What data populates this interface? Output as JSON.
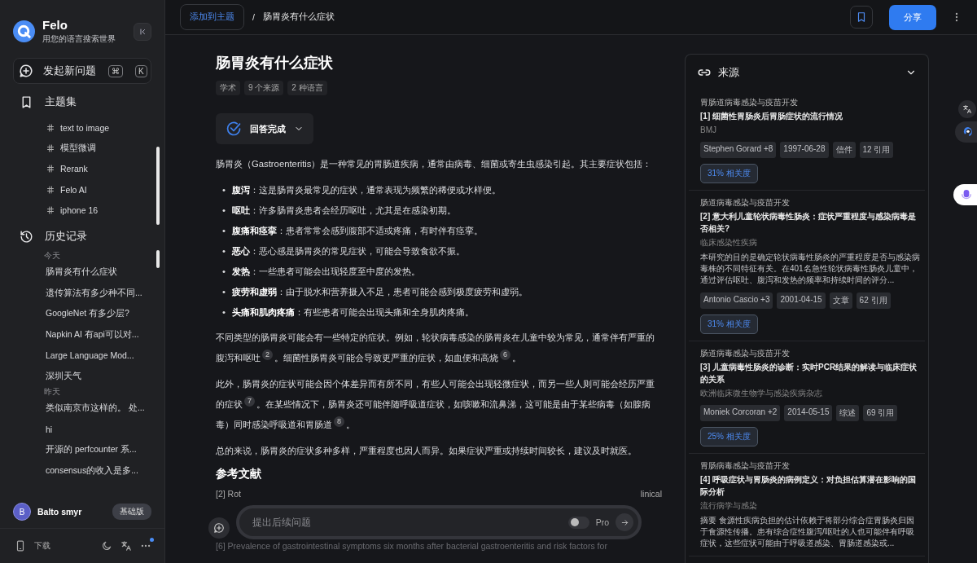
{
  "sidebar": {
    "brand": "Felo",
    "tagline": "用您的语言搜索世界",
    "new_question": {
      "label": "发起新问题",
      "keys": [
        "⌘",
        "K"
      ]
    },
    "topics": {
      "title": "主题集",
      "items": [
        "text to image",
        "模型微调",
        "Rerank",
        "Felo AI",
        "iphone 16"
      ]
    },
    "history": {
      "title": "历史记录",
      "groups": [
        {
          "label": "今天",
          "items": [
            "肠胃炎有什么症状",
            "遗传算法有多少种不同...",
            "GoogleNet 有多少层?",
            "Napkin AI 有api可以对...",
            "Large Language Mod...",
            "深圳天气"
          ]
        },
        {
          "label": "昨天",
          "items": [
            "类似南京市这样的。 处...",
            "hi",
            "开源的 perfcounter 系...",
            "consensus的收入是多..."
          ]
        }
      ]
    },
    "user": {
      "initial": "B",
      "name": "Balto smyr",
      "plan": "基础版"
    },
    "footer": {
      "download": "下载",
      "has_notification": true
    }
  },
  "topbar": {
    "add_topic": "添加到主题",
    "separator": "/",
    "breadcrumb": "肠胃炎有什么症状",
    "share": "分享"
  },
  "article": {
    "title": "肠胃炎有什么症状",
    "tags": [
      "学术",
      "9 个来源",
      "2 种语言"
    ],
    "status": "回答完成",
    "intro": "肠胃炎（Gastroenteritis）是一种常见的胃肠道疾病，通常由病毒、细菌或寄生虫感染引起。其主要症状包括：",
    "bullet_marker": "•",
    "bullets": [
      "**腹泻**：这是肠胃炎最常见的症状，通常表现为频繁的稀便或水样便。",
      "**呕吐**：许多肠胃炎患者会经历呕吐，尤其是在感染初期。",
      "**腹痛和痉挛**：患者常常会感到腹部不适或疼痛，有时伴有痉挛。",
      "**恶心**：恶心感是肠胃炎的常见症状，可能会导致食欲不振。",
      "**发热**：一些患者可能会出现轻度至中度的发热。",
      "**疲劳和虚弱**：由于脱水和营养摄入不足，患者可能会感到极度疲劳和虚弱。",
      "**头痛和肌肉疼痛**：有些患者可能会出现头痛和全身肌肉疼痛。"
    ],
    "paragraphs": [
      [
        {
          "text": "不同类型的肠胃炎可能会有一些特定的症状。例如，轮状病毒感染的肠胃炎在儿童中较为常见，通常伴有严重的腹泻和呕吐"
        },
        {
          "cite": "2"
        },
        {
          "text": "。细菌性肠胃炎可能会导致更严重的症状，如血便和高烧"
        },
        {
          "cite": "6"
        },
        {
          "text": "。"
        }
      ],
      [
        {
          "text": "此外，肠胃炎的症状可能会因个体差异而有所不同，有些人可能会出现轻微症状，而另一些人则可能会经历严重的症状"
        },
        {
          "cite": "7"
        },
        {
          "text": "。在某些情况下，肠胃炎还可能伴随呼吸道症状，如咳嗽和流鼻涕，这可能是由于某些病毒（如腺病毒）同时感染呼吸道和胃肠道"
        },
        {
          "cite": "8"
        },
        {
          "text": "。"
        }
      ],
      [
        {
          "text": "总的来说，肠胃炎的症状多种多样，严重程度也因人而异。如果症状严重或持续时间较长，建议及时就医。"
        }
      ]
    ],
    "references_title": "参考文献",
    "references": [
      {
        "start": "[2] Rot",
        "end": "linical"
      },
      {
        "start": "[6] Prevalence of gastrointestinal symptoms six months after bacterial gastroenteritis and risk factors for"
      }
    ],
    "followup": {
      "placeholder": "提出后续问题",
      "pro_label": "Pro",
      "pro_on": false
    }
  },
  "sources": {
    "title": "来源",
    "items": [
      {
        "category": "胃肠道病毒感染与疫苗开发",
        "title": "[1] 细菌性胃肠炎后胃肠症状的流行情况",
        "journal": "BMJ",
        "tags": [
          "Stephen Gorard +8",
          "1997-06-28",
          "信件",
          "12 引用"
        ],
        "relevance": "31% 相关度"
      },
      {
        "category": "肠道病毒感染与疫苗开发",
        "title": "[2] 意大利儿童轮状病毒性肠炎：症状严重程度与感染病毒是否相关?",
        "journal": "临床感染性疾病",
        "abstract": "本研究的目的是确定轮状病毒性肠炎的严重程度是否与感染病毒株的不同特征有关。在401名急性轮状病毒性肠炎儿童中，通过评估呕吐、腹泻和发热的频率和持续时间的评分...",
        "tags": [
          "Antonio Cascio +3",
          "2001-04-15",
          "文章",
          "62 引用"
        ],
        "relevance": "31% 相关度"
      },
      {
        "category": "肠道病毒感染与疫苗开发",
        "title": "[3] 儿童病毒性肠炎的诊断：实时PCR结果的解读与临床症状的关系",
        "journal": "欧洲临床微生物学与感染疾病杂志",
        "tags": [
          "Moniek Corcoran +2",
          "2014-05-15",
          "综述",
          "69 引用"
        ],
        "relevance": "25% 相关度"
      },
      {
        "category": "胃肠病毒感染与疫苗开发",
        "title": "[4] 呼吸症状与胃肠炎的病例定义：对负担估算潜在影响的国际分析",
        "journal": "流行病学与感染",
        "abstract": "摘要 食源性疾病负担的估计依赖于将部分综合症胃肠炎归因于食源性传播。患有综合症性腹泻/呕吐的人也可能伴有呼吸症状，这些症状可能由于呼吸道感染、胃肠道感染或..."
      }
    ]
  }
}
